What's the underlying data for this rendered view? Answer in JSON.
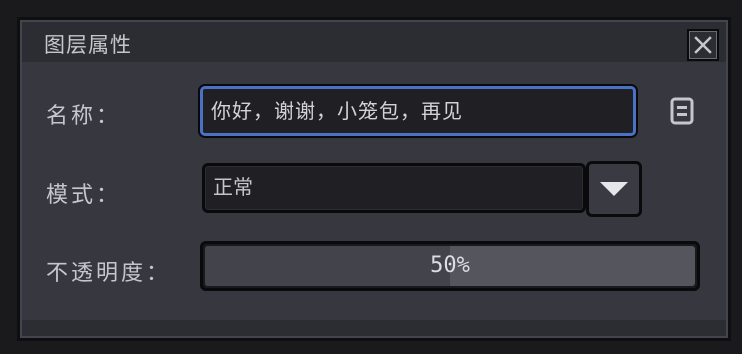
{
  "dialog": {
    "title": "图层属性",
    "close_icon": "close-icon"
  },
  "name_field": {
    "label": "名称：",
    "value": "你好，谢谢，小笼包，再见",
    "delete_icon": "trash-icon"
  },
  "mode_field": {
    "label": "模式：",
    "selected": "正常",
    "dropdown_icon": "chevron-down-icon"
  },
  "opacity_field": {
    "label": "不透明度：",
    "value": 50,
    "display": "50%"
  },
  "colors": {
    "panel": "#373740",
    "titlebar": "#2c2c33",
    "focus_border": "#4a72c4",
    "text": "#c6c6cc"
  }
}
